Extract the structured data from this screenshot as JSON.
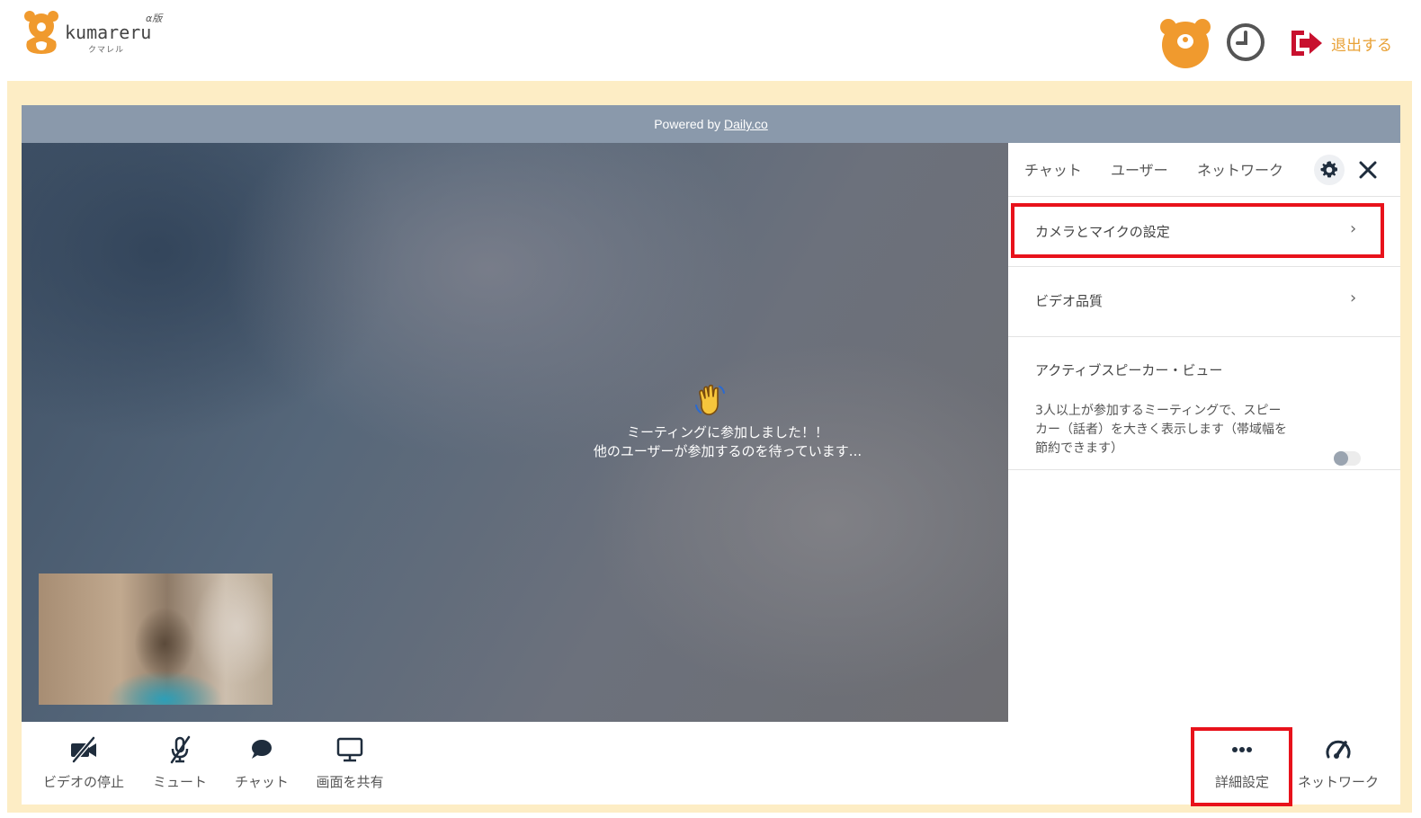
{
  "header": {
    "logo_text": "kumareru",
    "logo_sub": "クマレル",
    "logo_version": "α版",
    "logout_label": "退出する",
    "colors": {
      "accent": "#f09a2e",
      "logout": "#c8102e",
      "logout_text": "#e8a136"
    }
  },
  "banner": {
    "prefix": "Powered by ",
    "link": "Daily.co"
  },
  "video": {
    "message_line1": "ミーティングに参加しました！！",
    "message_line2": "他のユーザーが参加するのを待っています..."
  },
  "panel": {
    "tabs": [
      "チャット",
      "ユーザー",
      "ネットワーク"
    ],
    "items": [
      {
        "label": "カメラとマイクの設定",
        "chevron": "›"
      },
      {
        "label": "ビデオ品質",
        "chevron": "›"
      },
      {
        "label": "アクティブスピーカー・ビュー",
        "description": "3人以上が参加するミーティングで、スピーカー（話者）を大きく表示します（帯域幅を節約できます）",
        "toggle_on": false
      }
    ]
  },
  "toolbar": {
    "left": [
      {
        "label": "ビデオの停止",
        "icon": "video-off-icon"
      },
      {
        "label": "ミュート",
        "icon": "mic-off-icon"
      },
      {
        "label": "チャット",
        "icon": "chat-bubble-icon"
      },
      {
        "label": "画面を共有",
        "icon": "monitor-icon"
      }
    ],
    "right": [
      {
        "label": "詳細設定",
        "icon": "more-dots-icon"
      },
      {
        "label": "ネットワーク",
        "icon": "speedometer-icon"
      }
    ]
  },
  "highlight_color": "#e8121b"
}
